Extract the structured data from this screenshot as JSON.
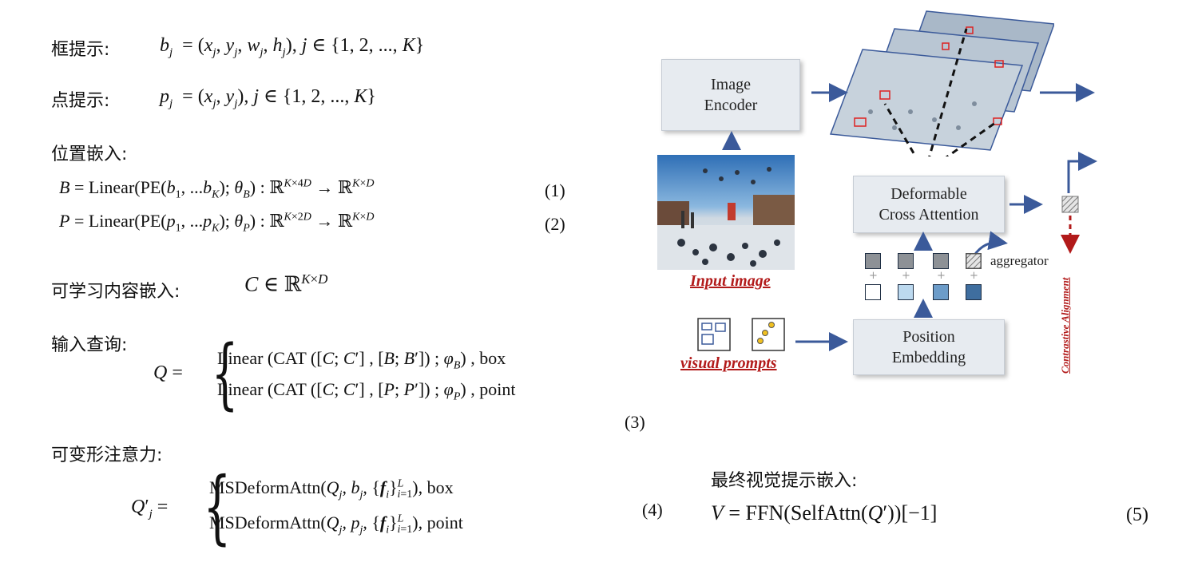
{
  "left": {
    "box_prompt": {
      "label": "框提示:",
      "formula": "b_j = (x_j, y_j, w_j, h_j), j ∈ {1, 2, ..., K}"
    },
    "point_prompt": {
      "label": "点提示:",
      "formula": "p_j = (x_j, y_j), j ∈ {1, 2, ..., K}"
    },
    "pos_embed": {
      "label": "位置嵌入:",
      "eq1": "B = Linear(PE(b_1, ...b_K); θ_B) : ℝ^{K×4D} → ℝ^{K×D}",
      "eq1_num": "(1)",
      "eq2": "P = Linear(PE(p_1, ...p_K); θ_P) : ℝ^{K×2D} → ℝ^{K×D}",
      "eq2_num": "(2)"
    },
    "content_embed": {
      "label": "可学习内容嵌入:",
      "formula": "C ∈ ℝ^{K×D}"
    },
    "query": {
      "label": "输入查询:",
      "lhs": "Q =",
      "case1": "Linear (CAT ([C; C′] , [B; B′]) ; φ_B) , box",
      "case2": "Linear (CAT ([C; C′] , [P; P′]) ; φ_P) , point",
      "num": "(3)"
    },
    "deform": {
      "label": "可变形注意力:",
      "lhs": "Q′_j =",
      "case1": "MSDeformAttn(Q_j, b_j, {f_i}_{i=1}^L), box",
      "case2": "MSDeformAttn(Q_j, p_j, {f_i}_{i=1}^L), point",
      "num": "(4)"
    }
  },
  "right": {
    "final": {
      "label": "最终视觉提示嵌入:",
      "formula": "V = FFN(SelfAttn(Q′))[−1]",
      "num": "(5)"
    },
    "diagram": {
      "image_encoder": "Image\nEncoder",
      "deformable_ca": "Deformable\nCross Attention",
      "position_embedding": "Position\nEmbedding",
      "aggregator": "aggregator",
      "input_image": "Input image",
      "visual_prompts": "visual prompts",
      "contrastive_alignment": "Contrastive Alignment",
      "colors": {
        "arrow": "#3b5a9a",
        "red": "#b21a1a",
        "box_bg": "#e7ebf0"
      }
    }
  }
}
